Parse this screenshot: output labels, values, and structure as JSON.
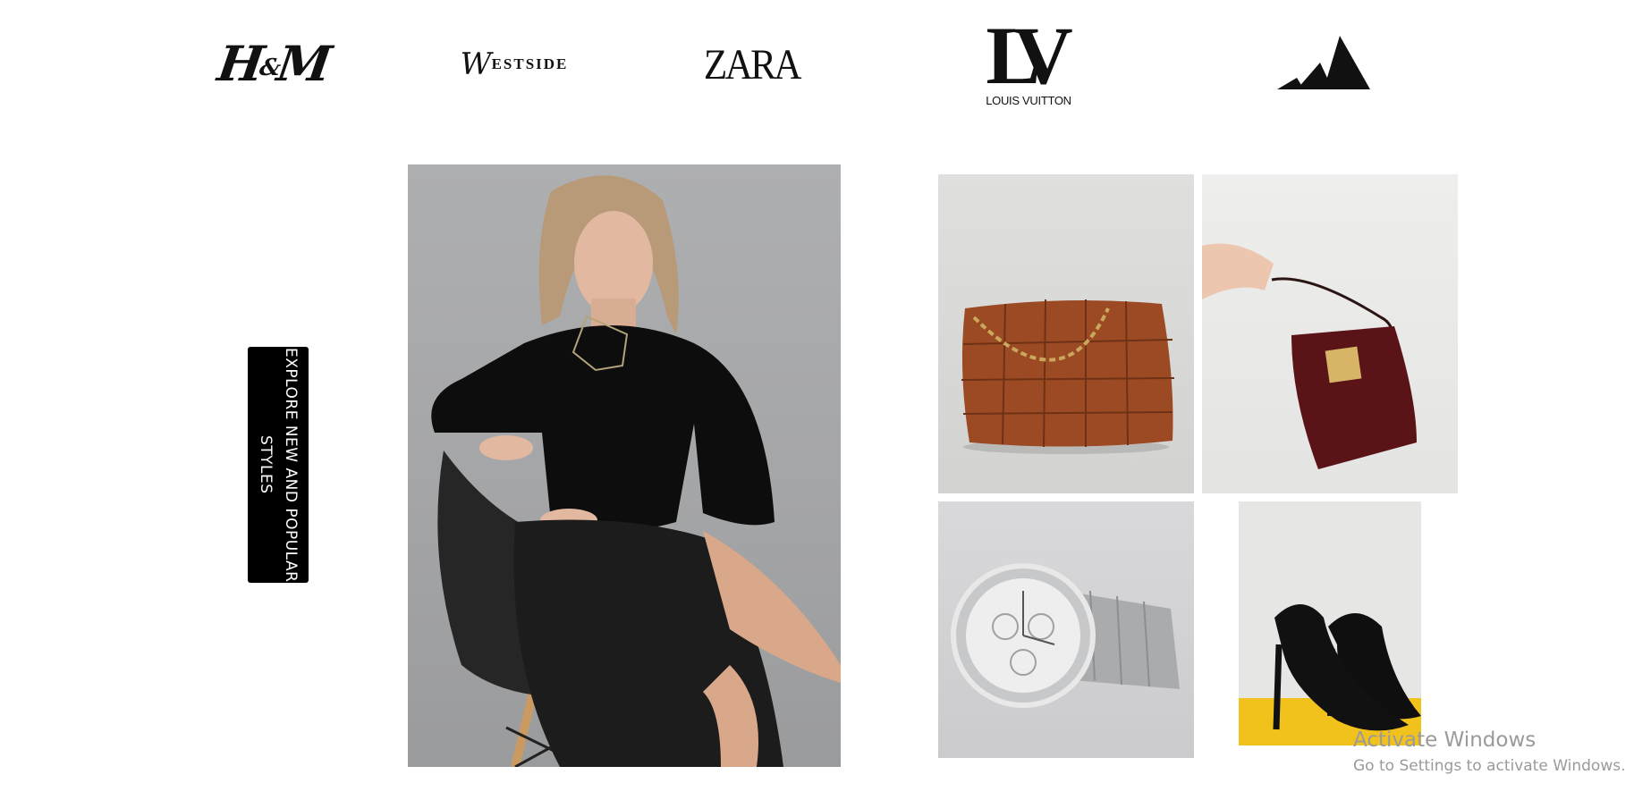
{
  "brands": {
    "hm": {
      "h": "H",
      "amp": "&",
      "m": "M"
    },
    "westside": {
      "initial": "W",
      "rest": "ESTSIDE"
    },
    "zara": {
      "text": "ZARA"
    },
    "louis_vuitton": {
      "monogram": "LV",
      "name": "LOUIS VUITTON"
    },
    "adidas": {
      "icon": "adidas-stripes-icon"
    }
  },
  "cta": {
    "label": "EXPLORE NEW AND POPULAR STYLES"
  },
  "images": {
    "hero": "woman-in-black-outfit-seated-photo",
    "bag1": "brown-woven-leather-tote-photo",
    "bag2": "burgundy-croc-handbag-photo",
    "watch": "silver-chronograph-watch-photo",
    "heels": "black-stiletto-heels-photo"
  },
  "colors": {
    "background": "#ffffff",
    "cta_bg": "#000000",
    "cta_text": "#ffffff",
    "watermark": "#9a9a9a"
  },
  "watermark": {
    "title": "Activate Windows",
    "subtitle": "Go to Settings to activate Windows."
  }
}
